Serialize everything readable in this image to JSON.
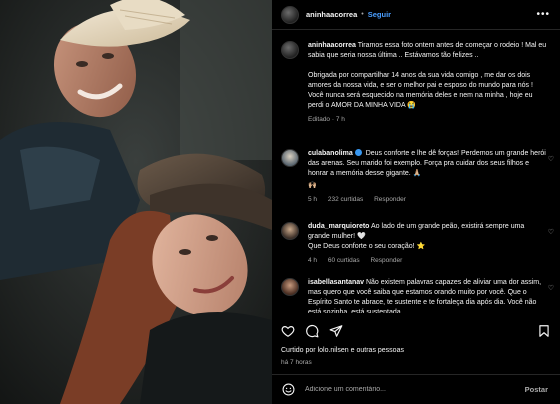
{
  "header": {
    "username": "aninhaacorrea",
    "separator": "•",
    "follow_label": "Seguir",
    "more_icon": "ellipsis-icon"
  },
  "caption": {
    "username": "aninhaacorrea",
    "text1": "Tiramos essa foto ontem antes de começar o rodeio ! Mal eu sabia que seria nossa última .. Estávamos tão felizes ..",
    "text2": "Obrigada por compartilhar 14 anos da sua vida comigo , me dar os dois amores da nossa vida, e ser o melhor pai e esposo do mundo para nós ! Você nunca será esquecido na memória deles e nem na minha , hoje eu perdi o AMOR DA MINHA VIDA 😭",
    "meta": "Editado · 7 h"
  },
  "comments": [
    {
      "username": "culabanolima",
      "verified": true,
      "text": "Deus conforte e lhe dê forças! Perdemos um grande herói das arenas. Seu marido foi exemplo. Força pra cuidar dos seus filhos e honrar a memória desse gigante. 🙏🏼",
      "extra": "🙌🏼",
      "time": "5 h",
      "likes": "232 curtidas",
      "reply": "Responder"
    },
    {
      "username": "duda_marquioreto",
      "verified": false,
      "text": "Ao lado de um grande peão, existirá sempre uma grande mulher! 🤍",
      "text2": "Que Deus conforte o seu coração! ⭐",
      "time": "4 h",
      "likes": "60 curtidas",
      "reply": "Responder"
    },
    {
      "username": "isabellasantanav",
      "verified": false,
      "text": "Não existem palavras capazes de aliviar uma dor assim, mas quero que você saiba que estamos orando muito por você. Que o Espírito Santo te abrace, te sustente e te fortaleça dia após dia. Você não está sozinha, está sustentada"
    }
  ],
  "footer": {
    "liked_by": "Curtido por lolo.nilsen e outras pessoas",
    "time": "há 7 horas",
    "add_comment_placeholder": "Adicione um comentário...",
    "post_label": "Postar"
  },
  "colors": {
    "background": "#000000",
    "link_blue": "#4a9eff",
    "secondary_text": "#a8a8a8",
    "divider": "#262626"
  }
}
